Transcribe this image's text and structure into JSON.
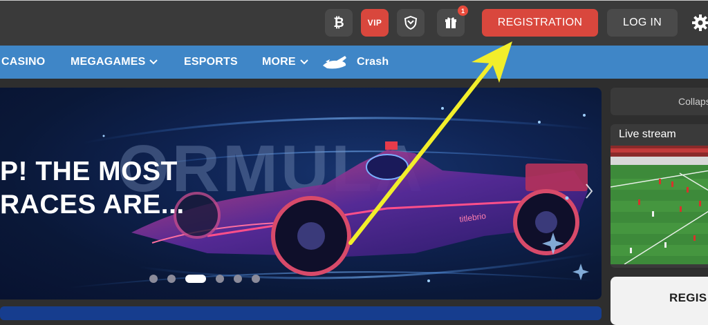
{
  "header": {
    "icons": [
      {
        "name": "bitcoin-icon"
      },
      {
        "name": "vip-icon",
        "label": "VIP"
      },
      {
        "name": "shield-icon"
      },
      {
        "name": "gift-icon",
        "badge": "1"
      }
    ],
    "registration_label": "REGISTRATION",
    "login_label": "LOG IN"
  },
  "nav": {
    "items": [
      {
        "label": "CASINO"
      },
      {
        "label": "MEGAGAMES"
      },
      {
        "label": "ESPORTS"
      },
      {
        "label": "MORE"
      },
      {
        "label": "Crash"
      }
    ]
  },
  "banner": {
    "line1": "P! THE MOST",
    "line2": "RACES ARE...",
    "watermark": "ORMULA",
    "car_decal": "titlebrio",
    "slide_count": 6,
    "active_slide": 3
  },
  "right_panel": {
    "collapse_label": "Collaps",
    "live_stream_label": "Live stream",
    "registration_card_label": "REGIS"
  },
  "colors": {
    "accent_red": "#d9473d",
    "nav_blue": "#3f86c7",
    "header_dark": "#3a3a3a",
    "arrow_yellow": "#f2ee2b"
  }
}
